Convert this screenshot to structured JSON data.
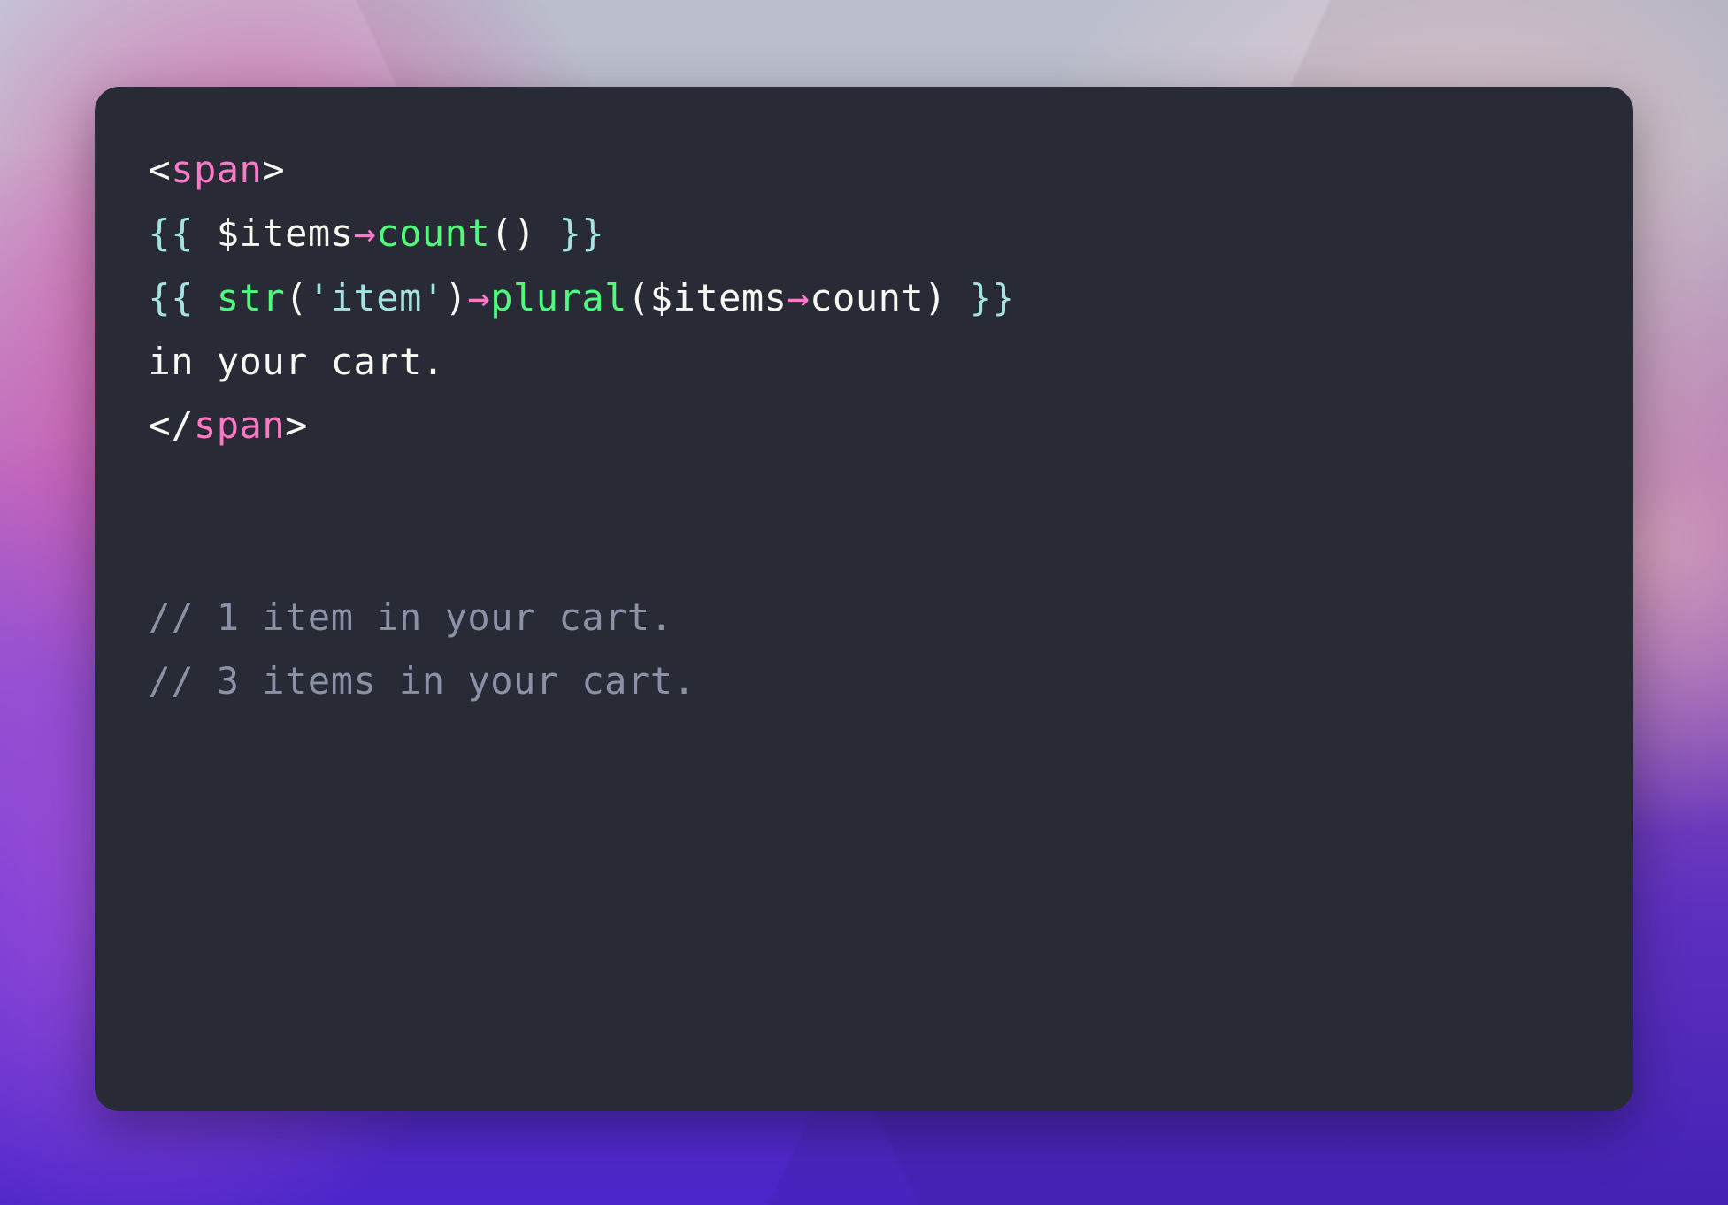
{
  "colors": {
    "card_bg": "#282a36",
    "fg": "#f8f8f2",
    "tag": "#ff79c6",
    "delim": "#a5e3e3",
    "arrow": "#ff79c6",
    "method": "#50fa7b",
    "string": "#a5e3e3",
    "comment": "#8b91a7"
  },
  "code": {
    "line1": {
      "open_angle": "<",
      "tag": "span",
      "close_angle": ">"
    },
    "line2": {
      "open_delim": "{{ ",
      "var": "$items",
      "arrow": "→",
      "method": "count",
      "parens": "()",
      "close_delim": " }}"
    },
    "line3": {
      "open_delim": "{{ ",
      "fn": "str",
      "open_paren": "(",
      "str": "'item'",
      "close_paren": ")",
      "arrow1": "→",
      "method": "plural",
      "open_paren2": "(",
      "var": "$items",
      "arrow2": "→",
      "prop": "count",
      "close_paren2": ")",
      "close_delim": " }}"
    },
    "line4": "in your cart.",
    "line5": {
      "open_angle": "</",
      "tag": "span",
      "close_angle": ">"
    },
    "line6": "",
    "line7": "",
    "line8": "// 1 item in your cart.",
    "line9": "// 3 items in your cart."
  }
}
